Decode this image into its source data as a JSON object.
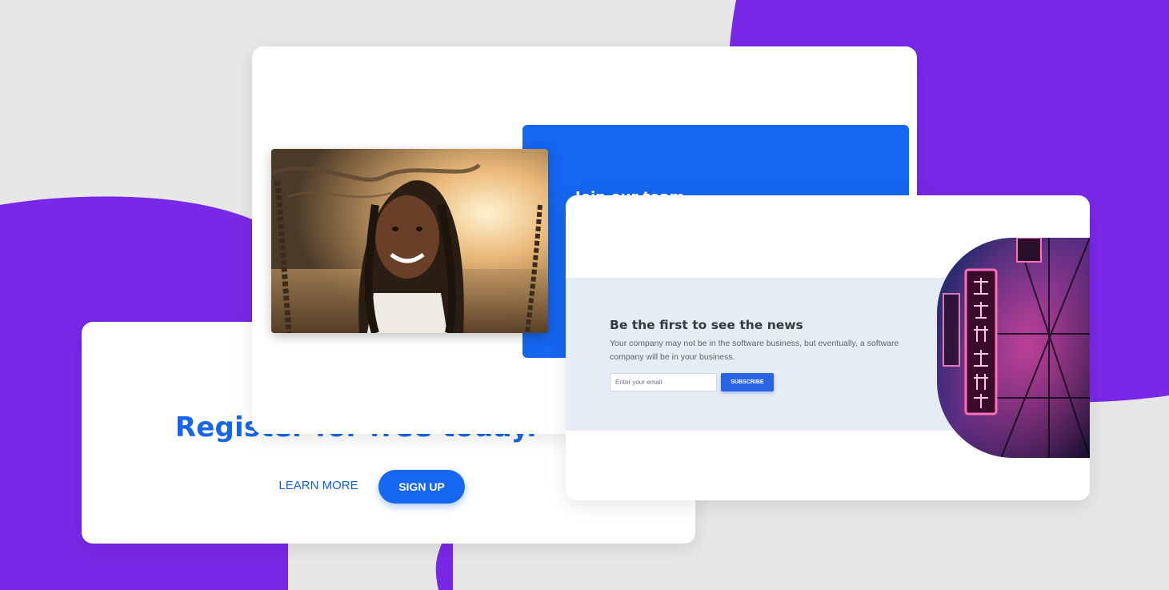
{
  "colors": {
    "accent_purple": "#7a28e8",
    "primary_blue": "#1566f0",
    "background": "#e7e7e7",
    "news_band": "#e6ecf5"
  },
  "register_card": {
    "heading": "Register for free today.",
    "learn_more_label": "LEARN MORE",
    "sign_up_label": "SIGN UP"
  },
  "team_card": {
    "title": "Join our team",
    "photo_icon": "portrait-photo"
  },
  "news_card": {
    "title": "Be the first to see the news",
    "description": "Your company may not be in the software business, but eventually, a software company will be in your business.",
    "email_placeholder": "Enter your email",
    "subscribe_label": "SUBSCRIBE",
    "photo_icon": "neon-sign-photo"
  }
}
